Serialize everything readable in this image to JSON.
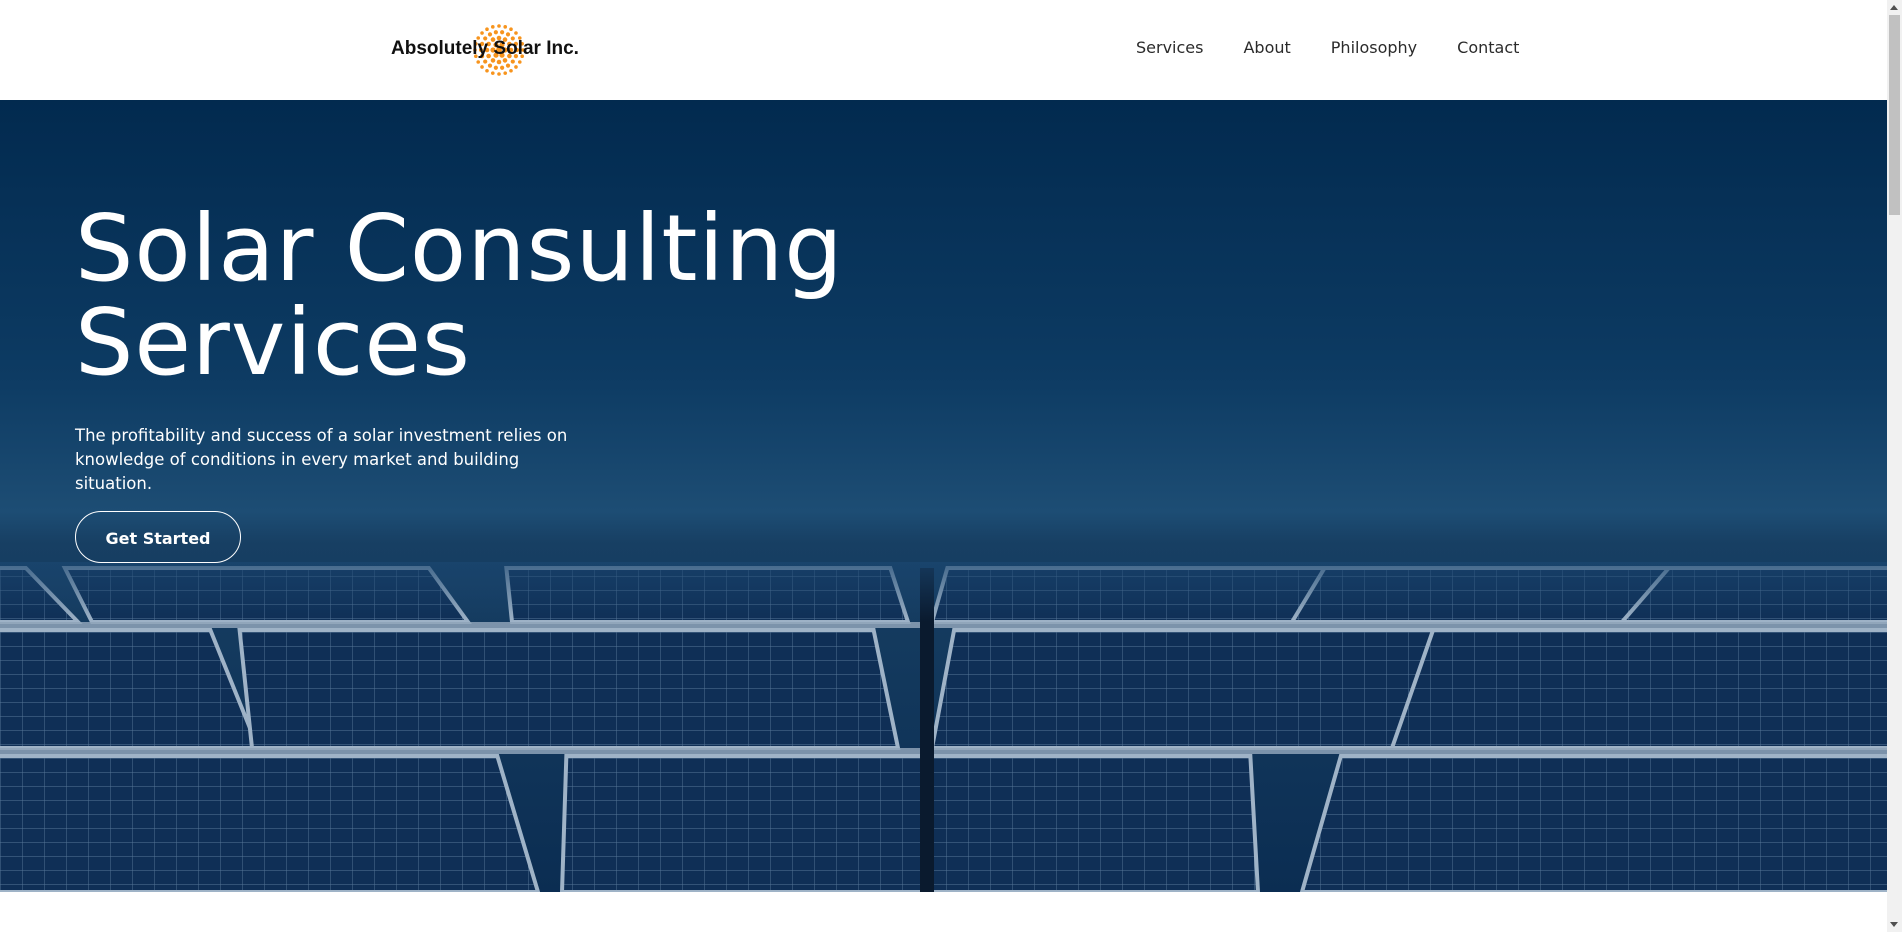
{
  "brand": {
    "name": "Absolutely Solar Inc.",
    "logo_icon": "sun-dots-icon",
    "accent_color": "#f7941d"
  },
  "nav": {
    "items": [
      {
        "label": "Services"
      },
      {
        "label": "About"
      },
      {
        "label": "Philosophy"
      },
      {
        "label": "Contact"
      }
    ]
  },
  "hero": {
    "title_line1": "Solar Consulting",
    "title_line2": "Services",
    "subtitle": "The profitability and success of a solar investment relies on knowledge of conditions in every market and building situation.",
    "cta_label": "Get Started",
    "background_image": "solar-panels-photo",
    "background_color": "#0b2d52"
  }
}
